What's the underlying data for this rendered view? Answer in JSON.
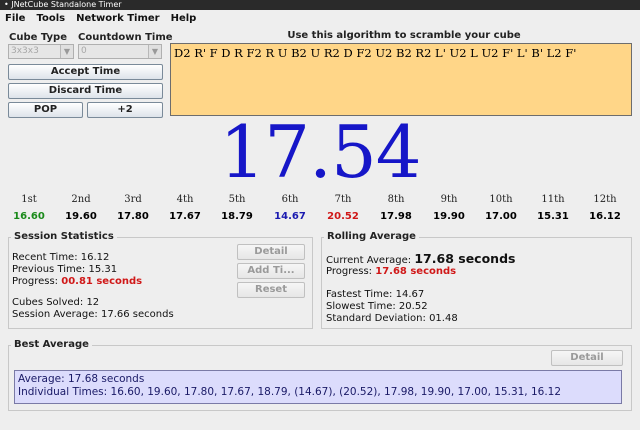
{
  "window": {
    "title": "• JNetCube Standalone Timer"
  },
  "menu": [
    "File",
    "Tools",
    "Network Timer",
    "Help"
  ],
  "cube_type": {
    "label": "Cube Type",
    "value": "3x3x3"
  },
  "countdown": {
    "label": "Countdown Time",
    "value": "0"
  },
  "buttons": {
    "accept": "Accept Time",
    "discard": "Discard Time",
    "pop": "POP",
    "plus2": "+2"
  },
  "scramble": {
    "header": "Use this algorithm to scramble your cube",
    "text": "D2 R' F D R F2 R U B2 U R2 D F2 U2 B2 R2 L' U2 L U2 F' L' B' L2 F'"
  },
  "timer": {
    "value": "17.54",
    "color": "#1616c8"
  },
  "times": [
    {
      "label": "1st",
      "value": "16.60",
      "color": "#1a8a1a"
    },
    {
      "label": "2nd",
      "value": "19.60",
      "color": "#111111"
    },
    {
      "label": "3rd",
      "value": "17.80",
      "color": "#111111"
    },
    {
      "label": "4th",
      "value": "17.67",
      "color": "#111111"
    },
    {
      "label": "5th",
      "value": "18.79",
      "color": "#111111"
    },
    {
      "label": "6th",
      "value": "14.67",
      "color": "#1a1ab0"
    },
    {
      "label": "7th",
      "value": "20.52",
      "color": "#d01818"
    },
    {
      "label": "8th",
      "value": "17.98",
      "color": "#111111"
    },
    {
      "label": "9th",
      "value": "19.90",
      "color": "#111111"
    },
    {
      "label": "10th",
      "value": "17.00",
      "color": "#111111"
    },
    {
      "label": "11th",
      "value": "15.31",
      "color": "#111111"
    },
    {
      "label": "12th",
      "value": "16.12",
      "color": "#111111"
    }
  ],
  "session": {
    "title": "Session Statistics",
    "recent_label": "Recent Time:",
    "recent_value": "16.12",
    "previous_label": "Previous Time:",
    "previous_value": "15.31",
    "progress_label": "Progress:",
    "progress_value": "00.81 seconds",
    "solved_label": "Cubes Solved:",
    "solved_value": "12",
    "average_label": "Session Average:",
    "average_value": "17.66 seconds",
    "detail_btn": "Detail",
    "addtime_btn": "Add Ti...",
    "reset_btn": "Reset"
  },
  "rolling": {
    "title": "Rolling Average",
    "current_label": "Current Average:",
    "current_value": "17.68 seconds",
    "progress_label": "Progress:",
    "progress_value": "17.68 seconds",
    "fastest_label": "Fastest Time:",
    "fastest_value": "14.67",
    "slowest_label": "Slowest Time:",
    "slowest_value": "20.52",
    "stddev_label": "Standard Deviation:",
    "stddev_value": "01.48"
  },
  "best": {
    "title": "Best Average",
    "detail_btn": "Detail",
    "average_line": "Average: 17.68 seconds",
    "times_line": "Individual Times: 16.60, 19.60, 17.80, 17.67, 18.79, (14.67), (20.52), 17.98, 19.90, 17.00, 15.31, 16.12"
  }
}
